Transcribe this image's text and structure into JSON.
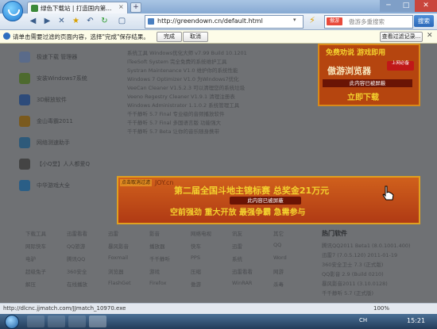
{
  "window": {
    "tab_title": "绿色下载站 | 打造国内第...",
    "tab_close": "×",
    "tab_add": "+",
    "min": "─",
    "max": "□",
    "close": "✕"
  },
  "toolbar": {
    "back": "◀",
    "forward": "▶",
    "stop": "✕",
    "favorite": "★",
    "undo": "↶",
    "refresh": "↻",
    "page": "▢",
    "url": "http://greendown.cn/default.html",
    "url_drop": "▾",
    "lightning": "⚡",
    "search_engine": "傲游",
    "search_placeholder": "傲游多重搜索",
    "search_button": "搜索"
  },
  "notification": {
    "text": "请单击需要过滤的页面内容，选择\"完成\"保存结果。",
    "done": "完成",
    "cancel": "取消",
    "rules": "查看过滤记录...",
    "close": "✕"
  },
  "left_apps": [
    {
      "name": "极速下载 管理器",
      "color": "#5a6b8a"
    },
    {
      "name": "安装Windows7系统",
      "color": "#4d6a2e"
    },
    {
      "name": "3D解放软件",
      "color": "#2d4b7a"
    },
    {
      "name": "金山毒霸2011",
      "color": "#7a5a1e"
    },
    {
      "name": "网络测速助手",
      "color": "#2e5a7a"
    },
    {
      "name": "【小Q堂】人人都爱Q",
      "color": "#444"
    },
    {
      "name": "中华游戏大全",
      "color": "#2a5e86"
    }
  ],
  "content_text": [
    "系统工具 Windows优化大师 v7.99 Build 10.1201",
    "ITeeSoft System 完全免费的系统维护工具",
    "Systran Maintenance V1.0 维护你的系统性能",
    "Windows 7 Optimizer V1.0 为Windows7优化",
    "VeeCan Cleaner V1.5.2.3 可以清理您的系统垃圾",
    "Veeno Regestry Cleaner V1.9.1 清理注册表",
    "Windows Administrator 1.1.0.2 系统管理工具",
    "千千静听 5.7 Final 专业级的音频播放软件",
    "千千静听 5.7 Final 多国语言版 功能强大",
    "千千静听 5.7 Beta 让你的音乐随身携带"
  ],
  "ad_right": {
    "line1": "免费劝说 游戏即用",
    "line2": "傲游浏览器",
    "badge": "上网必备",
    "blocked": "此内容已被屏蔽",
    "line3": "立即下载"
  },
  "ad_banner": {
    "tag": "点击取消过滤",
    "brand": "JOY.cn",
    "headline": "第二届全国斗地主锦标赛 总奖金21万元",
    "subline": "空前强劲 重大开放 最强争霸 急需参与",
    "blocked": "此内容已被屏蔽"
  },
  "bottom_columns": [
    [
      "下载工具",
      "迅雷看看",
      "迅雷",
      "影音",
      "网络电视",
      "讯友",
      "其它"
    ],
    [
      "网际快车",
      "QQ旅游",
      "暴风影音",
      "播放器",
      "快车",
      "迅雷",
      "QQ"
    ],
    [
      "电驴",
      "腾讯QQ",
      "Foxmail",
      "千千静听",
      "PPS",
      "系统",
      "Word"
    ],
    [
      "超级兔子",
      "360安全",
      "浏览器",
      "游戏",
      "压缩",
      "迅雷看看",
      "网游"
    ],
    [
      "解压",
      "在线播放",
      "FlashGet",
      "Firefox",
      "傲游",
      "WinRAR",
      "杀毒"
    ]
  ],
  "hot": {
    "title": "热门软件",
    "items": [
      "腾讯QQ2011 Beta1 (8.0.1001.400)",
      "迅雷7 (7.0.5.120) 2011-01-19",
      "360安全卫士 7.3 (正式版)",
      "QQ影音 2.9 (Build 0210)",
      "暴风影音2011 (3.10.0128)",
      "千千静听 5.7 (正式版)"
    ]
  },
  "statusbar": {
    "url": "http://dlcnc.jjmatch.com/JJmatch_10970.exe",
    "right": "100%"
  },
  "taskbar": {
    "lang": "CH",
    "clock": "15:21"
  }
}
